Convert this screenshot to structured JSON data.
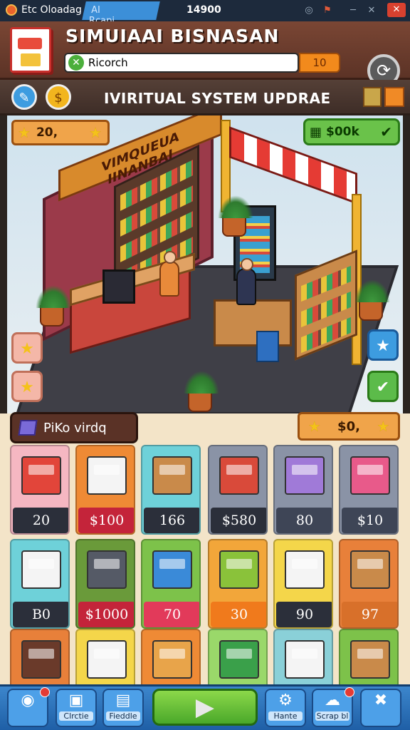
{
  "statusbar": {
    "app_name": "Etc Oloadag",
    "tab_labels": [
      "AI",
      "Rcapi"
    ],
    "time": "14900",
    "close_glyph": "✕"
  },
  "header": {
    "title": "SIMUIAAI BISNASAN",
    "search": {
      "value": "Ricorch",
      "clear_glyph": "✕"
    },
    "search_value_label": "10",
    "refresh_glyph": "⟳"
  },
  "update_bar": {
    "title": "IVIRITUAL SYSTEM UPDRAE",
    "left_buttons": [
      {
        "icon": "pencil-icon",
        "glyph": "✎"
      },
      {
        "icon": "coin-icon",
        "glyph": "$"
      }
    ],
    "right_icons": [
      "gift-box-icon",
      "crate-icon"
    ]
  },
  "scene": {
    "store_sign": "VIMQUEUA IINANBAI",
    "coins": {
      "value": "20,",
      "icon": "star-icon"
    },
    "cash": {
      "value": "$00k",
      "icon": "cash-icon"
    },
    "left_side_buttons": [
      "star-icon",
      "star-icon"
    ],
    "right_side_buttons": [
      "star-icon",
      "check-icon"
    ]
  },
  "category": {
    "label": "PiKo virdq",
    "value": "$0,"
  },
  "items": [
    {
      "name": "market-stall",
      "price": "20",
      "bg": "#f5b7c2",
      "price_bg": "#2b2f3a",
      "item_color": "#e2453a"
    },
    {
      "name": "white-box",
      "price": "$100",
      "bg": "#ef8a35",
      "price_bg": "#c4243a",
      "item_color": "#f4f4f4"
    },
    {
      "name": "crate",
      "price": "166",
      "bg": "#6ed1d9",
      "price_bg": "#2b2f3a",
      "item_color": "#c98a4a"
    },
    {
      "name": "snack-box",
      "price": "$580",
      "bg": "#8a93a6",
      "price_bg": "#2b2f3a",
      "item_color": "#d94a3a"
    },
    {
      "name": "cereal-box",
      "price": "80",
      "bg": "#8a93a6",
      "price_bg": "#3e4556",
      "item_color": "#a07ad8"
    },
    {
      "name": "jar-goods",
      "price": "$10",
      "bg": "#8a93a6",
      "price_bg": "#3e4556",
      "item_color": "#e85a8a"
    },
    {
      "name": "cooler-box",
      "price": "B0",
      "bg": "#6ed1d9",
      "price_bg": "#2b2f3a",
      "item_color": "#f4f4f4"
    },
    {
      "name": "safe-coins",
      "price": "$1000",
      "bg": "#6a9a3a",
      "price_bg": "#c4243a",
      "item_color": "#555a66"
    },
    {
      "name": "cereal-pack",
      "price": "70",
      "bg": "#7dc24a",
      "price_bg": "#e23a5a",
      "item_color": "#3a8ad8"
    },
    {
      "name": "green-box",
      "price": "30",
      "bg": "#f2a63a",
      "price_bg": "#f07a1c",
      "item_color": "#8ac23a"
    },
    {
      "name": "spray-box",
      "price": "90",
      "bg": "#f4d64a",
      "price_bg": "#2b2f3a",
      "item_color": "#f4f4f4"
    },
    {
      "name": "goods-shelf",
      "price": "97",
      "bg": "#e8803a",
      "price_bg": "#d8702a",
      "item_color": "#c98a4a"
    },
    {
      "name": "tea-box",
      "price": "",
      "bg": "#e8803a",
      "price_bg": "#e8803a",
      "item_color": "#6a3a2a"
    },
    {
      "name": "tissue-box",
      "price": "",
      "bg": "#f4d64a",
      "price_bg": "#f4d64a",
      "item_color": "#f4f4f4"
    },
    {
      "name": "brown-box",
      "price": "",
      "bg": "#ef8a35",
      "price_bg": "#ef8a35",
      "item_color": "#e8a44a"
    },
    {
      "name": "snack-tray",
      "price": "",
      "bg": "#9ad86a",
      "price_bg": "#9ad86a",
      "item_color": "#3aa04a"
    },
    {
      "name": "storage-box",
      "price": "",
      "bg": "#8ad0d8",
      "price_bg": "#8ad0d8",
      "item_color": "#f4f4f4"
    },
    {
      "name": "produce-crate",
      "price": "",
      "bg": "#7dc24a",
      "price_bg": "#7dc24a",
      "item_color": "#c98a4a"
    }
  ],
  "bottom_nav": [
    {
      "key": "camera",
      "icon": "camera-icon",
      "glyph": "◉",
      "label": ""
    },
    {
      "key": "create",
      "icon": "box-icon",
      "glyph": "▣",
      "label": "Clrctie"
    },
    {
      "key": "reddle",
      "icon": "register-icon",
      "glyph": "▤",
      "label": "Fieddle"
    },
    {
      "key": "play",
      "icon": "play-icon",
      "glyph": "▶",
      "label": ""
    },
    {
      "key": "settings",
      "icon": "gear-icon",
      "glyph": "⚙",
      "label": "Hante"
    },
    {
      "key": "scrap",
      "icon": "cloud-icon",
      "glyph": "☁",
      "label": "Scrap bl"
    },
    {
      "key": "tools",
      "icon": "tools-icon",
      "glyph": "✖",
      "label": ""
    }
  ]
}
